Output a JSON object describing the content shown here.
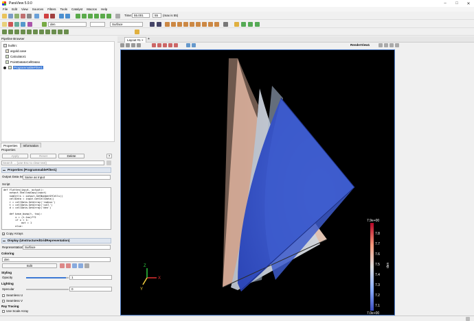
{
  "window": {
    "title": "ParaView 5.9.0"
  },
  "menu": [
    "File",
    "Edit",
    "View",
    "Sources",
    "Filters",
    "Tools",
    "Catalyst",
    "Macros",
    "Help"
  ],
  "toolbar": {
    "time_label": "Time:",
    "time_value": "55.001",
    "time_step": "55",
    "time_max": "(max is 55)",
    "variable_combo": "den",
    "representation_combo": "Surface"
  },
  "pipeline": {
    "title": "Pipeline Browser",
    "items": [
      {
        "label": "builtin:"
      },
      {
        "label": "argold.case"
      },
      {
        "label": "Calculator1"
      },
      {
        "label": "PointDatatoCellData1"
      },
      {
        "label": "ProgrammableFilter1"
      }
    ]
  },
  "tabs": {
    "properties": "Properties",
    "information": "Information"
  },
  "properties": {
    "header": "Properties",
    "apply": "Apply",
    "reset": "Reset",
    "delete": "Delete",
    "help": "?",
    "search_placeholder": "Search ... (use Esc to clear text)",
    "group_title": "Properties (ProgrammableFilter1)",
    "output_label": "Output Data Set Type",
    "output_value": "Same as Input",
    "script_label": "Script",
    "script": "def flatten(input, output):\n    output.ShallowCopy(input)\n    numCells = output.GetNumberOfCells()\n    cellData = input.GetCellData()\n    r = cellData.GetArray('radius')\n    t = cellData.GetArray('coll')\n    d = cellData.GetArray('den')\n\n    def base_bump(t, tau):\n        x = (t-tau)**2\n        if x < 1:\n            out = 1\n        else:",
    "copy_arrays": "Copy Arrays",
    "display_title": "Display (UnstructuredGridRepresentation)",
    "representation_label": "Representation",
    "representation_value": "Surface",
    "coloring_label": "Coloring",
    "coloring_value": "den",
    "edit": "Edit",
    "styling_label": "Styling",
    "opacity_label": "Opacity",
    "opacity_value": "1",
    "lighting_label": "Lighting",
    "specular_label": "Specular",
    "specular_value": "0",
    "seamless_u": "Seamless U",
    "seamless_v": "Seamless V",
    "ray_tracing_label": "Ray Tracing",
    "use_scale_array": "Use Scale Array"
  },
  "layout_tab": "Layout #1",
  "render_view_label": "RenderView1",
  "colorbar": {
    "title": "den",
    "max": "7.9e+00",
    "min": "7.0e+00",
    "ticks": [
      "7.8",
      "7.7",
      "7.6",
      "7.5",
      "7.4",
      "7.3",
      "7.2",
      "7.1"
    ]
  },
  "axes": {
    "x": "X",
    "y": "Y",
    "z": "Z"
  },
  "colors": {
    "selection": "#3b78d4",
    "viewport_bg": "#000000",
    "outer_shell": "#d8b2a0",
    "middle_shell": "#c8ccd4",
    "inner_core": "#3f5fcf"
  }
}
